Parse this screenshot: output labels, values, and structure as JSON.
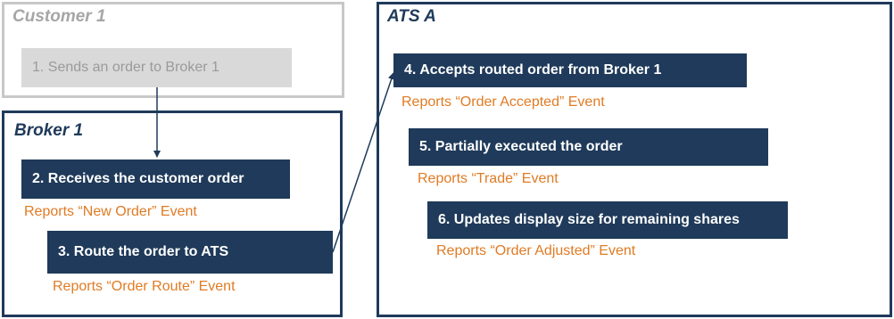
{
  "colors": {
    "navy": "#1f3a5a",
    "event_orange": "#e07b24",
    "customer_border": "#c8c8c8",
    "customer_title": "#a6a6a6"
  },
  "customer": {
    "title": "Customer 1",
    "step1": "1. Sends an order to Broker 1"
  },
  "broker": {
    "title": "Broker 1",
    "step2": "2. Receives the customer order",
    "event2": "Reports “New Order” Event",
    "step3": "3. Route the order to ATS",
    "event3": "Reports “Order Route” Event"
  },
  "ats": {
    "title": "ATS A",
    "step4": "4. Accepts routed order from Broker 1",
    "event4": "Reports “Order Accepted” Event",
    "step5": "5.  Partially executed the order",
    "event5": "Reports “Trade” Event",
    "step6": "6.  Updates display size for remaining shares",
    "event6": "Reports “Order Adjusted” Event"
  }
}
